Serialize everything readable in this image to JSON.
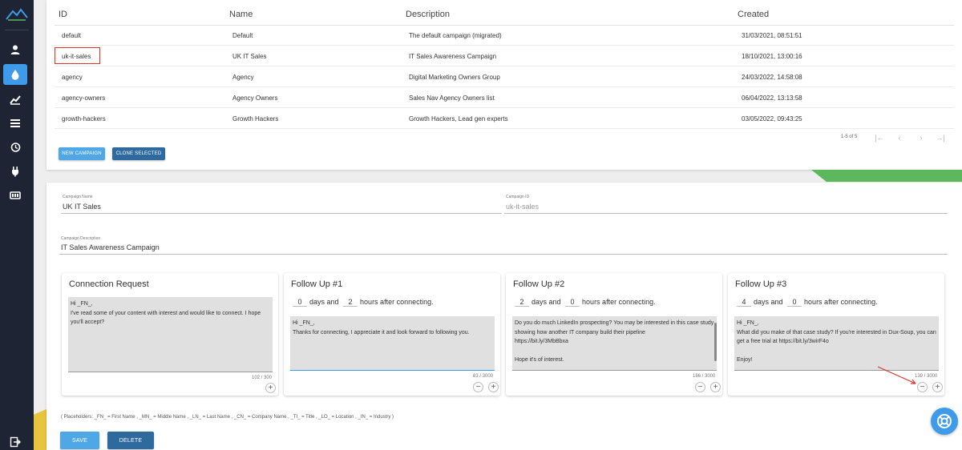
{
  "sidebar": {
    "items": [
      {
        "icon": "user-icon"
      },
      {
        "icon": "drop-icon",
        "active": true
      },
      {
        "icon": "chart-icon"
      },
      {
        "icon": "list-icon"
      },
      {
        "icon": "history-icon"
      },
      {
        "icon": "plug-icon"
      },
      {
        "icon": "queue-icon"
      }
    ],
    "logout_icon": "logout-icon",
    "active_color": "#3d9be9"
  },
  "table": {
    "columns": [
      "ID",
      "Name",
      "Description",
      "Created"
    ],
    "rows": [
      {
        "id": "default",
        "name": "Default",
        "description": "The default campaign (migrated)",
        "created": "31/03/2021, 08:51:51"
      },
      {
        "id": "uk-it-sales",
        "name": "UK IT Sales",
        "description": "IT Sales Awareness Campaign",
        "created": "18/10/2021, 13:00:16"
      },
      {
        "id": "agency",
        "name": "Agency",
        "description": "Digital Marketing Owners Group",
        "created": "24/03/2022, 14:58:08"
      },
      {
        "id": "agency-owners",
        "name": "Agency Owners",
        "description": "Sales Nav Agency Owners list",
        "created": "06/04/2022, 13:13:58"
      },
      {
        "id": "growth-hackers",
        "name": "Growth Hackers",
        "description": "Growth Hackers, Lead gen experts",
        "created": "03/05/2022, 09:43:25"
      }
    ],
    "pagination": "1-5 of 5",
    "pager_icons": [
      "|←",
      "‹",
      "›",
      "→|"
    ]
  },
  "buttons": {
    "new_campaign": "NEW CAMPAIGN",
    "clone_selected": "CLONE SELECTED",
    "save": "SAVE",
    "delete": "DELETE"
  },
  "form": {
    "name_label": "Campaign Name",
    "name_value": "UK IT Sales",
    "id_label": "Campaign ID",
    "id_value": "uk-it-sales",
    "desc_label": "Campaign Description",
    "desc_value": "IT Sales Awareness Campaign"
  },
  "cards": [
    {
      "title": "Connection Request",
      "message": "Hi _FN_,\nI've read some of your content with interest and would like to connect. I hope you'll accept?",
      "count": "102 / 300"
    },
    {
      "title": "Follow Up #1",
      "days": "0",
      "hours": "2",
      "days_text": "days and",
      "hours_text": "hours after connecting.",
      "message": "Hi _FN_,\nThanks for connecting, I appreciate it and look forward to following you.",
      "count": "83 / 3000"
    },
    {
      "title": "Follow Up #2",
      "days": "2",
      "hours": "0",
      "days_text": "days and",
      "hours_text": "hours after connecting.",
      "message": "Do you do much LinkedIn prospecting? You may be interested in this case study showing how another IT company build their pipeline\nhttps://bit.ly/3MbBbxa\n\nHope it's of interest.",
      "count": "186 / 3000"
    },
    {
      "title": "Follow Up #3",
      "days": "4",
      "hours": "0",
      "days_text": "days and",
      "hours_text": "hours after connecting.",
      "message": "Hi _FN_,\nWhat did you make of that case study? If you're interested in Dux-Soup, you can get a free trial at https://bit.ly/3wirF4o\n\nEnjoy!",
      "count": "139 / 3000"
    }
  ],
  "placeholders_text": "( Placeholders: _FN_ = First Name , _MN_ = Middle Name , _LN_ = Last Name , _CN_ = Company Name , _TI_ = Title , _LO_ = Location , _IN_ = Industry )",
  "help_icon": "lifebuoy-icon",
  "colors": {
    "primary": "#3d9be9",
    "dark_button": "#2e6a9e",
    "highlight": "#d9352b",
    "green": "#5cb85c"
  }
}
